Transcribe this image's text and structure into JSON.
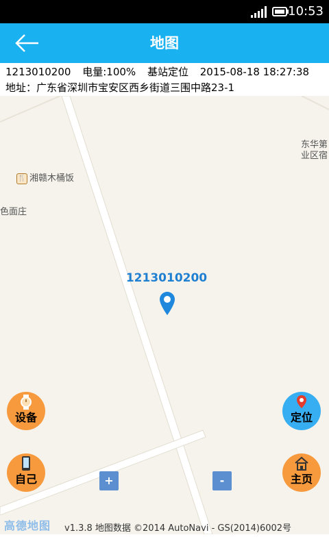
{
  "status": {
    "time": "10:53"
  },
  "header": {
    "title": "地图"
  },
  "info": {
    "device_id": "1213010200",
    "battery": "电量:100%",
    "locate_mode": "基站定位",
    "datetime": "2015-08-18 18:27:38",
    "address": "地址：广东省深圳市宝安区西乡街道三围中路23-1"
  },
  "map": {
    "poi_food": "湘赣木桶饭",
    "poi_east_line1": "东华第",
    "poi_east_line2": "业区宿",
    "poi_west": "色面庄",
    "device_label": "1213010200",
    "logo": "高德地图",
    "copyright": "v1.3.8 地图数据 ©2014 AutoNavi - GS(2014)6002号"
  },
  "buttons": {
    "device": "设备",
    "locate": "定位",
    "self": "自己",
    "home": "主页",
    "zoom_in": "+",
    "zoom_out": "-"
  },
  "colors": {
    "header": "#1ab1f0",
    "orange_button": "#f79a3e",
    "blue_button": "#38aef2",
    "marker": "#1f7fd1"
  }
}
